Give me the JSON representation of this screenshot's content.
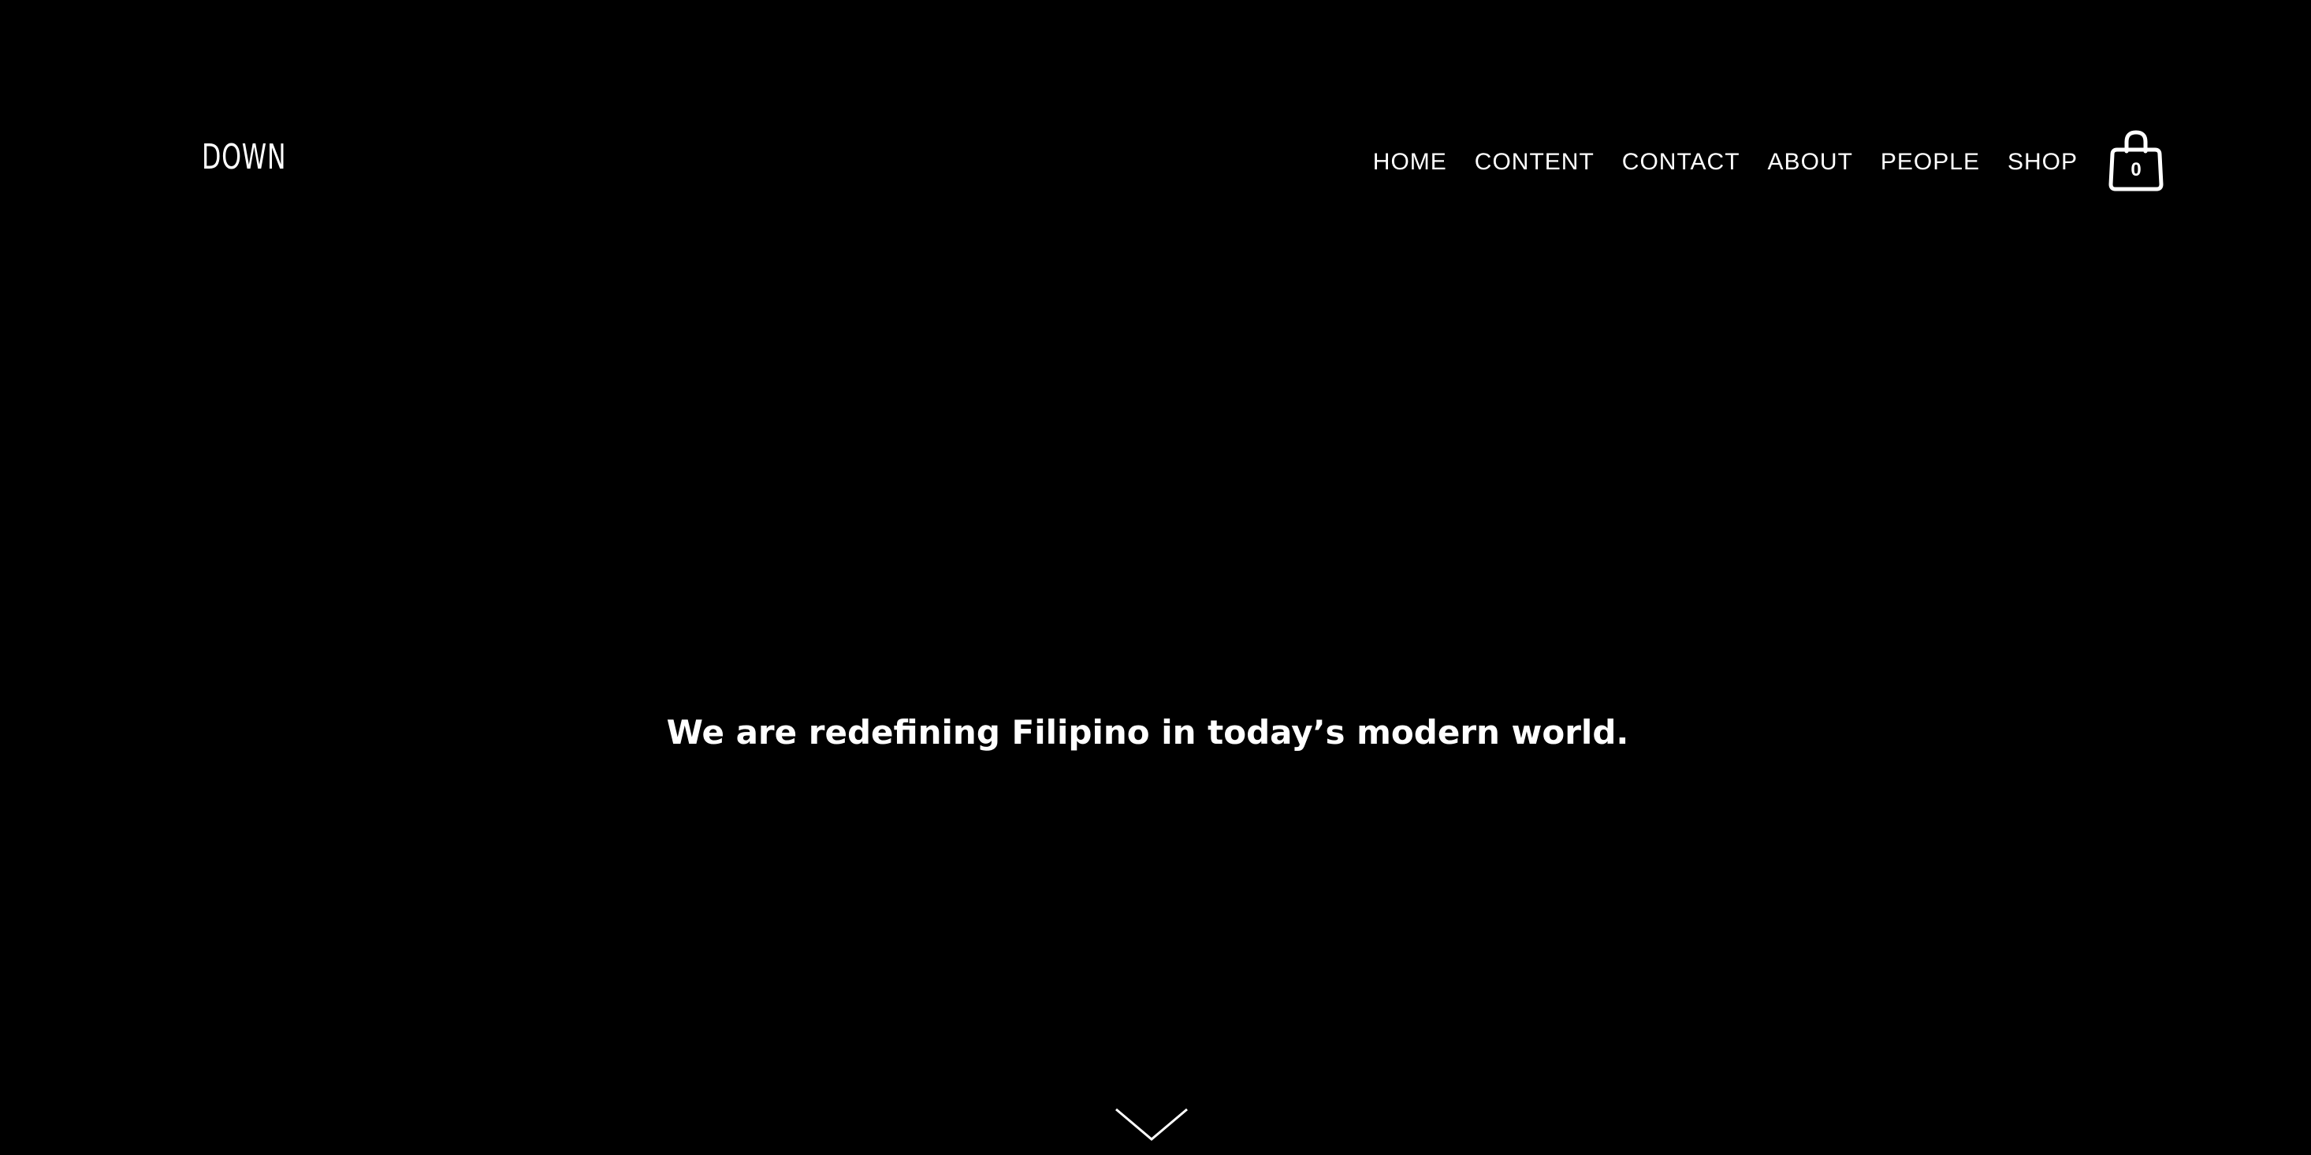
{
  "header": {
    "logo_text": "DOWN",
    "nav_items": [
      {
        "label": "HOME"
      },
      {
        "label": "CONTENT"
      },
      {
        "label": "CONTACT"
      },
      {
        "label": "ABOUT"
      },
      {
        "label": "PEOPLE"
      },
      {
        "label": "SHOP"
      }
    ],
    "cart": {
      "icon": "shopping-bag-icon",
      "count": "0"
    }
  },
  "hero": {
    "tagline": "We are redefining Filipino in today’s modern world.",
    "scroll_icon": "chevron-down-icon"
  },
  "colors": {
    "background": "#000000",
    "text": "#ffffff"
  }
}
